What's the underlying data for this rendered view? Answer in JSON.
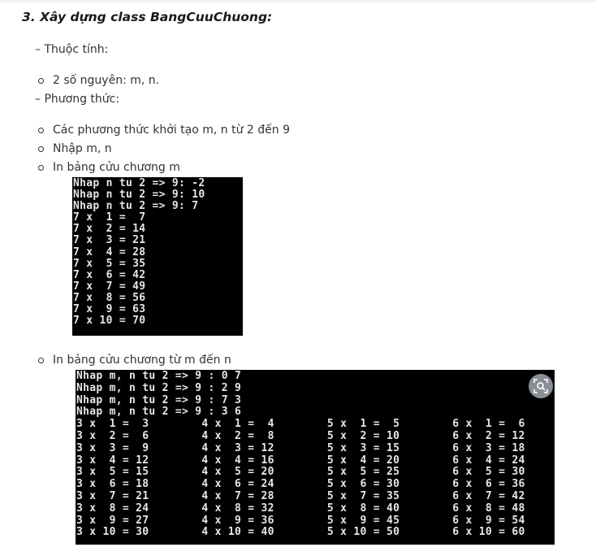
{
  "heading": "3. Xây dựng class BangCuuChuong:",
  "attributes_label": "– Thuộc tính:",
  "attributes_items": [
    "2 số nguyên: m, n."
  ],
  "methods_label": "– Phương thức:",
  "methods_items": [
    "Các phương thức khởi tạo m, n từ 2 đến 9",
    "Nhập m, n",
    "In bảng cửu chương m",
    "In bảng cửu chương từ m đến n"
  ],
  "console1": {
    "lines": [
      "Nhap n tu 2 => 9: -2",
      "Nhap n tu 2 => 9: 10",
      "Nhap n tu 2 => 9: 7",
      "7 x  1 =  7",
      "7 x  2 = 14",
      "7 x  3 = 21",
      "7 x  4 = 28",
      "7 x  5 = 35",
      "7 x  6 = 42",
      "7 x  7 = 49",
      "7 x  8 = 56",
      "7 x  9 = 63",
      "7 x 10 = 70"
    ]
  },
  "console2": {
    "lines": [
      "Nhap m, n tu 2 => 9 : 0 7",
      "Nhap m, n tu 2 => 9 : 2 9",
      "Nhap m, n tu 2 => 9 : 7 3",
      "Nhap m, n tu 2 => 9 : 3 6",
      "3 x  1 =  3        4 x  1 =  4        5 x  1 =  5        6 x  1 =  6",
      "3 x  2 =  6        4 x  2 =  8        5 x  2 = 10        6 x  2 = 12",
      "3 x  3 =  9        4 x  3 = 12        5 x  3 = 15        6 x  3 = 18",
      "3 x  4 = 12        4 x  4 = 16        5 x  4 = 20        6 x  4 = 24",
      "3 x  5 = 15        4 x  5 = 20        5 x  5 = 25        6 x  5 = 30",
      "3 x  6 = 18        4 x  6 = 24        5 x  6 = 30        6 x  6 = 36",
      "3 x  7 = 21        4 x  7 = 28        5 x  7 = 35        6 x  7 = 42",
      "3 x  8 = 24        4 x  8 = 32        5 x  8 = 40        6 x  8 = 48",
      "3 x  9 = 27        4 x  9 = 36        5 x  9 = 45        6 x  9 = 54",
      "3 x 10 = 30        4 x 10 = 40        5 x 10 = 50        6 x 10 = 60"
    ]
  },
  "icons": {
    "image_search": "lens-search-icon"
  },
  "colors": {
    "text": "#333333",
    "console_bg": "#000000",
    "console_text": "#e6e6e6",
    "lens_button": "#8a8f96"
  }
}
